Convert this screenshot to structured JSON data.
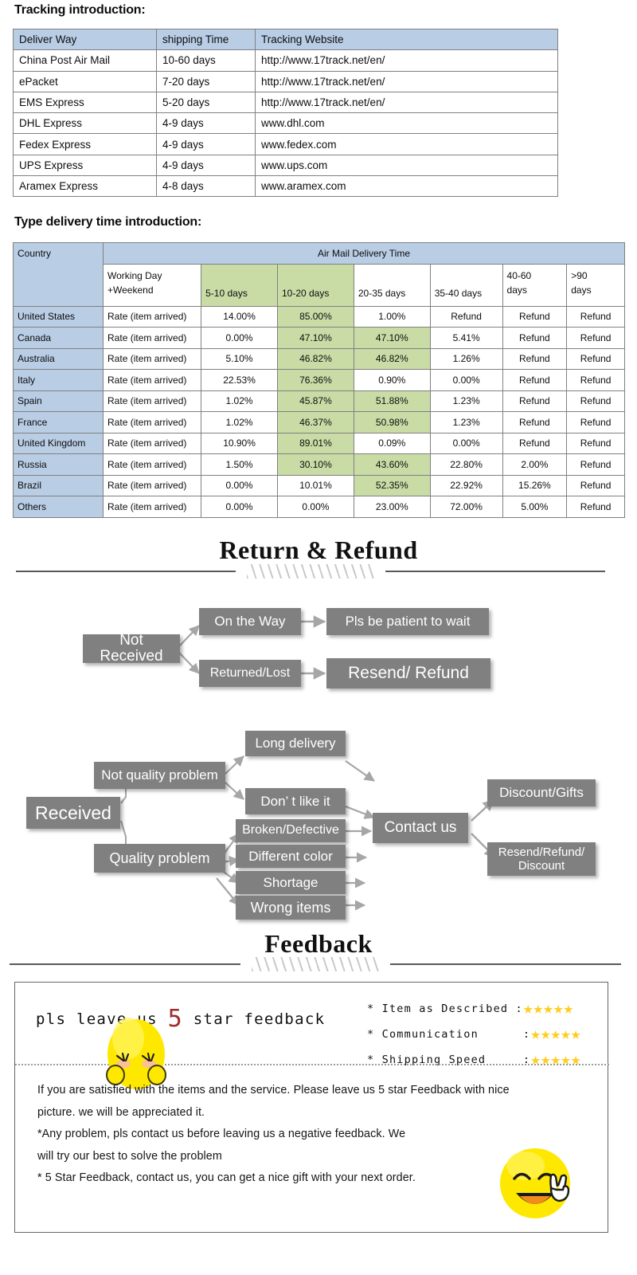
{
  "tracking": {
    "heading": "Tracking introduction:",
    "columns": [
      "Deliver Way",
      "shipping Time",
      "Tracking Website"
    ],
    "rows": [
      [
        "China Post Air Mail",
        "10-60 days",
        "http://www.17track.net/en/"
      ],
      [
        "ePacket",
        "7-20 days",
        "http://www.17track.net/en/"
      ],
      [
        "EMS Express",
        "5-20 days",
        "http://www.17track.net/en/"
      ],
      [
        "DHL Express",
        "4-9 days",
        "www.dhl.com"
      ],
      [
        "Fedex Express",
        "4-9 days",
        "www.fedex.com"
      ],
      [
        "UPS Express",
        "4-9 days",
        "www.ups.com"
      ],
      [
        "Aramex Express",
        "4-8 days",
        "www.aramex.com"
      ]
    ]
  },
  "delivery": {
    "heading": "Type delivery time introduction:",
    "country_header": "Country",
    "span_header": "Air Mail Delivery Time",
    "sub_headers": [
      "Working Day\n+Weekend",
      "5-10 days",
      "10-20 days",
      "20-35 days",
      "35-40 days",
      "40-60\ndays",
      ">90\ndays"
    ],
    "sub_headers_flat": [
      "Working Day +Weekend",
      "5-10 days",
      "10-20 days",
      "20-35 days",
      "35-40 days",
      "40-60 days",
      ">90 days"
    ],
    "rate_label": "Rate (item arrived)",
    "rows": [
      {
        "country": "United States",
        "values": [
          "14.00%",
          "85.00%",
          "1.00%",
          "Refund",
          "Refund",
          "Refund"
        ],
        "green": [
          1
        ]
      },
      {
        "country": "Canada",
        "values": [
          "0.00%",
          "47.10%",
          "47.10%",
          "5.41%",
          "Refund",
          "Refund"
        ],
        "green": [
          1,
          2
        ]
      },
      {
        "country": "Australia",
        "values": [
          "5.10%",
          "46.82%",
          "46.82%",
          "1.26%",
          "Refund",
          "Refund"
        ],
        "green": [
          1,
          2
        ]
      },
      {
        "country": "Italy",
        "values": [
          "22.53%",
          "76.36%",
          "0.90%",
          "0.00%",
          "Refund",
          "Refund"
        ],
        "green": [
          1
        ]
      },
      {
        "country": "Spain",
        "values": [
          "1.02%",
          "45.87%",
          "51.88%",
          "1.23%",
          "Refund",
          "Refund"
        ],
        "green": [
          1,
          2
        ]
      },
      {
        "country": "France",
        "values": [
          "1.02%",
          "46.37%",
          "50.98%",
          "1.23%",
          "Refund",
          "Refund"
        ],
        "green": [
          1,
          2
        ]
      },
      {
        "country": "United Kingdom",
        "values": [
          "10.90%",
          "89.01%",
          "0.09%",
          "0.00%",
          "Refund",
          "Refund"
        ],
        "green": [
          1
        ]
      },
      {
        "country": "Russia",
        "values": [
          "1.50%",
          "30.10%",
          "43.60%",
          "22.80%",
          "2.00%",
          "Refund"
        ],
        "green": [
          1,
          2
        ]
      },
      {
        "country": "Brazil",
        "values": [
          "0.00%",
          "10.01%",
          "52.35%",
          "22.92%",
          "15.26%",
          "Refund"
        ],
        "green": [
          2
        ]
      },
      {
        "country": "Others",
        "values": [
          "0.00%",
          "0.00%",
          "23.00%",
          "72.00%",
          "5.00%",
          "Refund"
        ],
        "green": []
      }
    ],
    "header_green_cols": [
      2,
      3
    ]
  },
  "return_refund": {
    "title": "Return & Refund",
    "not_received": "Not Received",
    "on_the_way": "On the Way",
    "pls_wait": "Pls be patient to wait",
    "returned_lost": "Returned/Lost",
    "resend_refund": "Resend/ Refund",
    "received": "Received",
    "not_quality": "Not quality problem",
    "quality": "Quality problem",
    "long_delivery": "Long delivery",
    "dont_like": "Don’ t like it",
    "broken": "Broken/Defective",
    "different_color": "Different color",
    "shortage": "Shortage",
    "wrong_items": "Wrong items",
    "contact_us": "Contact us",
    "discount_gifts": "Discount/Gifts",
    "resend_refund_discount": "Resend/Refund/ Discount"
  },
  "feedback": {
    "title": "Feedback",
    "lead_pre": "pls leave us ",
    "lead_num": "5",
    "lead_post": " star feedback",
    "ratings": [
      {
        "label": "* Item as Described :",
        "stars": "★★★★★"
      },
      {
        "label": "* Communication      :",
        "stars": "★★★★★"
      },
      {
        "label": "* Shipping Speed     :",
        "stars": "★★★★★"
      }
    ],
    "body_lines": [
      "If you are satisfied with the items and the service. Please leave us 5 star Feedback with nice",
      "picture. we will be appreciated it.",
      "*Any problem, pls contact us before leaving us a negative feedback. We",
      "will try our best to solve  the problem",
      "* 5 Star Feedback, contact us, you can get a nice gift with your next order."
    ]
  },
  "colors": {
    "header_blue": "#b9cde5",
    "highlight_green": "#c9dca6",
    "flow_box_gray": "#808080",
    "star_yellow": "#FFCD1E",
    "accent_red": "#9c2b2b"
  }
}
